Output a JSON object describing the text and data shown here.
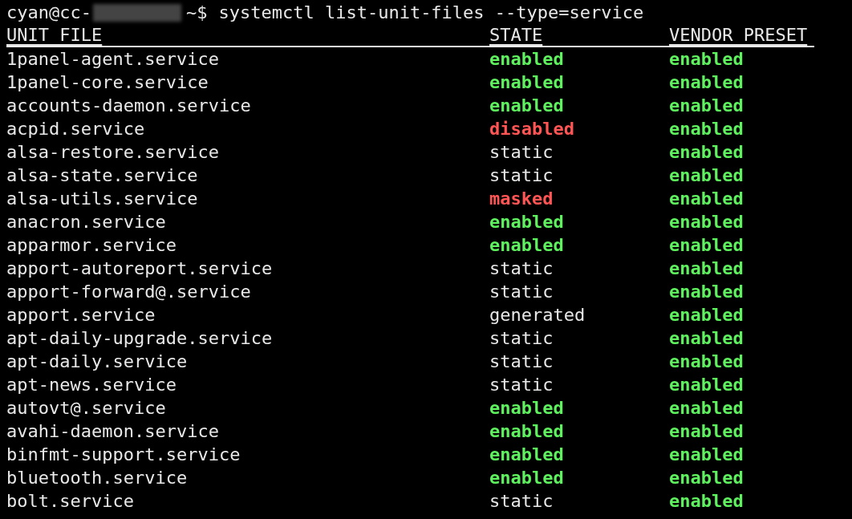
{
  "prompt": {
    "user_host": "cyan@cc-",
    "path": "~$",
    "command": "systemctl list-unit-files --type=service"
  },
  "table": {
    "columns": [
      "UNIT FILE",
      "STATE",
      "VENDOR PRESET"
    ],
    "rows": [
      {
        "unit": "1panel-agent.service",
        "state": {
          "text": "enabled",
          "color": "#5ff25f"
        },
        "preset": {
          "text": "enabled",
          "color": "#5ff25f"
        }
      },
      {
        "unit": "1panel-core.service",
        "state": {
          "text": "enabled",
          "color": "#5ff25f"
        },
        "preset": {
          "text": "enabled",
          "color": "#5ff25f"
        }
      },
      {
        "unit": "accounts-daemon.service",
        "state": {
          "text": "enabled",
          "color": "#5ff25f"
        },
        "preset": {
          "text": "enabled",
          "color": "#5ff25f"
        }
      },
      {
        "unit": "acpid.service",
        "state": {
          "text": "disabled",
          "color": "#ff5555"
        },
        "preset": {
          "text": "enabled",
          "color": "#5ff25f"
        }
      },
      {
        "unit": "alsa-restore.service",
        "state": {
          "text": "static"
        },
        "preset": {
          "text": "enabled",
          "color": "#5ff25f"
        }
      },
      {
        "unit": "alsa-state.service",
        "state": {
          "text": "static"
        },
        "preset": {
          "text": "enabled",
          "color": "#5ff25f"
        }
      },
      {
        "unit": "alsa-utils.service",
        "state": {
          "text": "masked",
          "color": "#ff5555"
        },
        "preset": {
          "text": "enabled",
          "color": "#5ff25f"
        }
      },
      {
        "unit": "anacron.service",
        "state": {
          "text": "enabled",
          "color": "#5ff25f"
        },
        "preset": {
          "text": "enabled",
          "color": "#5ff25f"
        }
      },
      {
        "unit": "apparmor.service",
        "state": {
          "text": "enabled",
          "color": "#5ff25f"
        },
        "preset": {
          "text": "enabled",
          "color": "#5ff25f"
        }
      },
      {
        "unit": "apport-autoreport.service",
        "state": {
          "text": "static"
        },
        "preset": {
          "text": "enabled",
          "color": "#5ff25f"
        }
      },
      {
        "unit": "apport-forward@.service",
        "state": {
          "text": "static"
        },
        "preset": {
          "text": "enabled",
          "color": "#5ff25f"
        }
      },
      {
        "unit": "apport.service",
        "state": {
          "text": "generated"
        },
        "preset": {
          "text": "enabled",
          "color": "#5ff25f"
        }
      },
      {
        "unit": "apt-daily-upgrade.service",
        "state": {
          "text": "static"
        },
        "preset": {
          "text": "enabled",
          "color": "#5ff25f"
        }
      },
      {
        "unit": "apt-daily.service",
        "state": {
          "text": "static"
        },
        "preset": {
          "text": "enabled",
          "color": "#5ff25f"
        }
      },
      {
        "unit": "apt-news.service",
        "state": {
          "text": "static"
        },
        "preset": {
          "text": "enabled",
          "color": "#5ff25f"
        }
      },
      {
        "unit": "autovt@.service",
        "state": {
          "text": "enabled",
          "color": "#5ff25f"
        },
        "preset": {
          "text": "enabled",
          "color": "#5ff25f"
        }
      },
      {
        "unit": "avahi-daemon.service",
        "state": {
          "text": "enabled",
          "color": "#5ff25f"
        },
        "preset": {
          "text": "enabled",
          "color": "#5ff25f"
        }
      },
      {
        "unit": "binfmt-support.service",
        "state": {
          "text": "enabled",
          "color": "#5ff25f"
        },
        "preset": {
          "text": "enabled",
          "color": "#5ff25f"
        }
      },
      {
        "unit": "bluetooth.service",
        "state": {
          "text": "enabled",
          "color": "#5ff25f"
        },
        "preset": {
          "text": "enabled",
          "color": "#5ff25f"
        }
      },
      {
        "unit": "bolt.service",
        "state": {
          "text": "static"
        },
        "preset": {
          "text": "enabled",
          "color": "#5ff25f"
        }
      }
    ]
  }
}
